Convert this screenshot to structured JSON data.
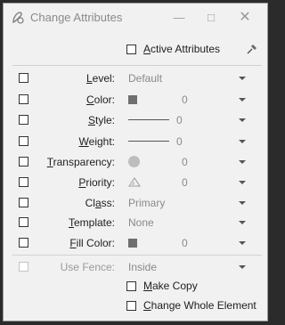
{
  "window": {
    "title": "Change Attributes"
  },
  "active_attributes": {
    "label_first": "A",
    "label_rest": "ctive Attributes"
  },
  "rows": [
    {
      "label_pre": "",
      "label_u": "L",
      "label_post": "evel:",
      "value": "Default",
      "num": ""
    },
    {
      "label_pre": "",
      "label_u": "C",
      "label_post": "olor:",
      "value": "",
      "num": "0"
    },
    {
      "label_pre": "",
      "label_u": "S",
      "label_post": "tyle:",
      "value": "",
      "num": "0"
    },
    {
      "label_pre": "",
      "label_u": "W",
      "label_post": "eight:",
      "value": "",
      "num": "0"
    },
    {
      "label_pre": "",
      "label_u": "T",
      "label_post": "ransparency:",
      "value": "",
      "num": "0"
    },
    {
      "label_pre": "",
      "label_u": "P",
      "label_post": "riority:",
      "value": "",
      "num": "0"
    },
    {
      "label_pre": "Cl",
      "label_u": "a",
      "label_post": "ss:",
      "value": "Primary",
      "num": ""
    },
    {
      "label_pre": "",
      "label_u": "T",
      "label_post": "emplate:",
      "value": "None",
      "num": ""
    },
    {
      "label_pre": "",
      "label_u": "F",
      "label_post": "ill Color:",
      "value": "",
      "num": "0"
    }
  ],
  "use_fence": {
    "label": "Use Fence:",
    "value": "Inside"
  },
  "make_copy": {
    "label_u": "M",
    "label_rest": "ake Copy"
  },
  "change_whole": {
    "label_u": "C",
    "label_rest": "hange Whole Element"
  }
}
